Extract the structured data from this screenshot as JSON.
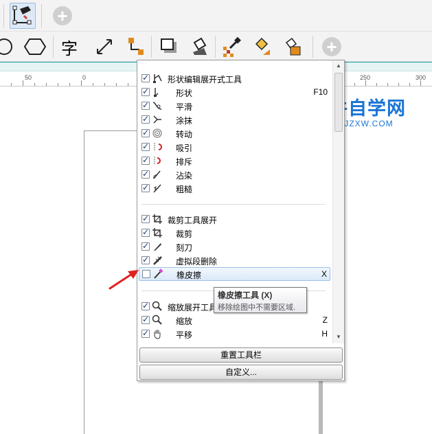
{
  "toolbar_top": {
    "add_label": "+"
  },
  "toolbar_main": {
    "text_tool_glyph": "字",
    "add_label": "+"
  },
  "ruler": {
    "labels": [
      "50",
      "0",
      "250",
      "300"
    ]
  },
  "menu": {
    "groups": [
      {
        "header": {
          "label": "形状编辑展开式工具",
          "checked": true,
          "icon": "shape-flyout-icon"
        },
        "items": [
          {
            "label": "形状",
            "checked": true,
            "shortcut": "F10",
            "icon": "shape-icon"
          },
          {
            "label": "平滑",
            "checked": true,
            "shortcut": "",
            "icon": "smooth-icon"
          },
          {
            "label": "涂抹",
            "checked": true,
            "shortcut": "",
            "icon": "smear-icon"
          },
          {
            "label": "转动",
            "checked": true,
            "shortcut": "",
            "icon": "twirl-icon"
          },
          {
            "label": "吸引",
            "checked": true,
            "shortcut": "",
            "icon": "attract-icon"
          },
          {
            "label": "排斥",
            "checked": true,
            "shortcut": "",
            "icon": "repel-icon"
          },
          {
            "label": "沾染",
            "checked": true,
            "shortcut": "",
            "icon": "smudge-icon"
          },
          {
            "label": "粗糙",
            "checked": true,
            "shortcut": "",
            "icon": "roughen-icon"
          }
        ]
      },
      {
        "header": {
          "label": "裁剪工具展开",
          "checked": true,
          "icon": "crop-flyout-icon"
        },
        "items": [
          {
            "label": "裁剪",
            "checked": true,
            "shortcut": "",
            "icon": "crop-icon"
          },
          {
            "label": "刻刀",
            "checked": true,
            "shortcut": "",
            "icon": "knife-icon"
          },
          {
            "label": "虚拟段删除",
            "checked": true,
            "shortcut": "",
            "icon": "virtual-segment-delete-icon"
          },
          {
            "label": "橡皮擦",
            "checked": false,
            "shortcut": "X",
            "icon": "eraser-icon"
          }
        ]
      },
      {
        "header": {
          "label": "缩放展开工具",
          "checked": true,
          "icon": "zoom-flyout-icon"
        },
        "items": [
          {
            "label": "缩放",
            "checked": true,
            "shortcut": "Z",
            "icon": "zoom-icon"
          },
          {
            "label": "平移",
            "checked": true,
            "shortcut": "H",
            "icon": "pan-icon"
          }
        ]
      }
    ],
    "buttons": {
      "reset": "重置工具栏",
      "customize": "自定义..."
    }
  },
  "tooltip": {
    "title": "橡皮擦工具 (X)",
    "description": "移除绘图中不需要区域."
  },
  "watermark": {
    "title": "软件自学网",
    "url": "WWW.RJZXW.COM"
  },
  "colors": {
    "accent": "#1aa0a8",
    "watermark": "#1a74d6",
    "arrow": "#e02020",
    "highlight": "#dbe9f9"
  }
}
